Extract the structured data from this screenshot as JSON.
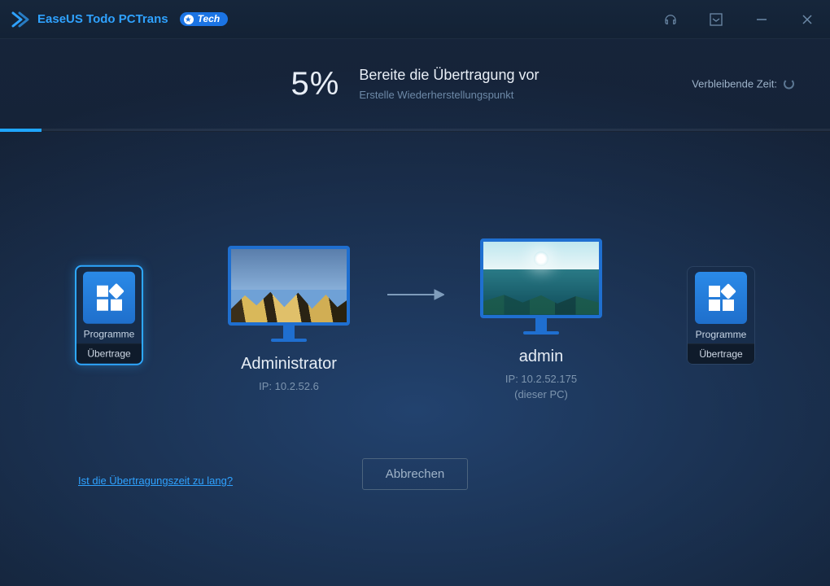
{
  "titlebar": {
    "app_name": "EaseUS Todo PCTrans",
    "badge": "Tech"
  },
  "progress": {
    "percent_text": "5%",
    "percent_value": 5,
    "title": "Bereite die Übertragung vor",
    "subtitle": "Erstelle Wiederherstellungspunkt",
    "remaining_label": "Verbleibende Zeit:"
  },
  "side": {
    "left": {
      "label": "Programme",
      "status": "Übertrage"
    },
    "right": {
      "label": "Programme",
      "status": "Übertrage"
    }
  },
  "source_pc": {
    "name": "Administrator",
    "ip_label": "IP: 10.2.52.6"
  },
  "dest_pc": {
    "name": "admin",
    "ip_label": "IP: 10.2.52.175",
    "note": "(dieser PC)"
  },
  "footer": {
    "help_link": "Ist die Übertragungszeit zu lang?",
    "cancel": "Abbrechen"
  }
}
